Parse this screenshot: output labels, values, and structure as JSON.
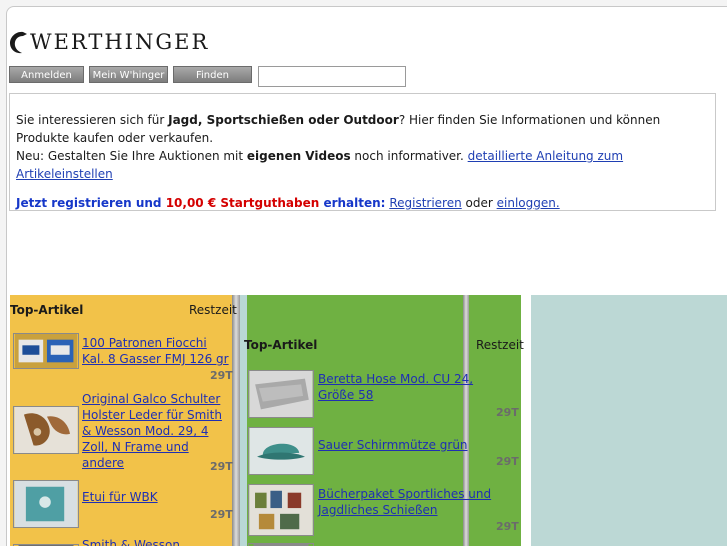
{
  "logo": {
    "text": "WERTHINGER"
  },
  "toolbar": {
    "login_label": "Anmelden",
    "account_label": "Mein W'hinger",
    "find_label": "Finden",
    "search_value": ""
  },
  "intro": {
    "line1_pre": "Sie interessieren sich für ",
    "line1_bold": "Jagd, Sportschießen oder Outdoor",
    "line1_post": "? Hier finden Sie Informationen und können Produkte kaufen oder verkaufen.",
    "line2_pre": "Neu: Gestalten Sie Ihre Auktionen mit ",
    "line2_bold": "eigenen Videos",
    "line2_mid": " noch informativer. ",
    "line2_link": "detaillierte Anleitung zum Artikeleinstellen",
    "reg_pre": "Jetzt registrieren und ",
    "reg_amount": "10,00 € Startguthaben",
    "reg_post": " erhalten:",
    "reg_link": "Registrieren",
    "reg_or": " oder ",
    "login_link": "einloggen."
  },
  "left_column": {
    "heading": "Top-Artikel",
    "time_heading": "Restzeit",
    "items": [
      {
        "title": "100 Patronen Fiocchi Kal. 8 Gasser FMJ 126 gr",
        "time": "29T"
      },
      {
        "title": "Original Galco Schulter Holster Leder für Smith & Wesson Mod. 29, 4 Zoll, N Frame und andere",
        "time": "29T"
      },
      {
        "title": "Etui für WBK",
        "time": "29T"
      },
      {
        "title": "Smith & Wesson Magazin",
        "time": ""
      }
    ]
  },
  "mid_column": {
    "heading": "Top-Artikel",
    "time_heading": "Restzeit",
    "items": [
      {
        "title": "Beretta Hose Mod. CU 24, Größe 58",
        "time": "29T"
      },
      {
        "title": "Sauer Schirmmütze grün",
        "time": "29T"
      },
      {
        "title": "Bücherpaket Sportliches und Jagdliches Schießen",
        "time": "29T"
      }
    ]
  },
  "colors": {
    "yellow": "#f2c249",
    "green": "#6fb142",
    "teal": "#bcd8d5",
    "link": "#1f2fb3",
    "accent_blue": "#1637c9",
    "accent_red": "#d40000"
  }
}
